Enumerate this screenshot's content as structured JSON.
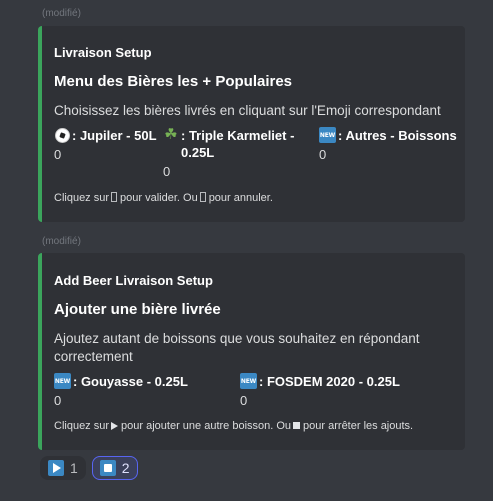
{
  "messages": [
    {
      "edited": "(modifié)",
      "author": "Livraison Setup",
      "title": "Menu des Bières les + Populaires",
      "description": "Choisissez les bières livrés en cliquant sur l'Emoji correspondant",
      "fields": [
        {
          "emoji": "soccer-ball",
          "name": ": Jupiler - 50L",
          "value": "0"
        },
        {
          "emoji": "four-leaf-clover",
          "name": ": Triple Karmeliet - 0.25L",
          "value": "0"
        },
        {
          "emoji": "new-button",
          "name": ": Autres - Boissons",
          "value": "0"
        }
      ],
      "footer": {
        "before": "Cliquez sur",
        "middle": "pour valider. Ou",
        "after": "pour annuler."
      }
    },
    {
      "edited": "(modifié)",
      "author": "Add Beer Livraison Setup",
      "title": "Ajouter une bière livrée",
      "description": "Ajoutez autant de boissons que vous souhaitez en répondant correctement",
      "fields": [
        {
          "emoji": "new-button",
          "name": ": Gouyasse - 0.25L",
          "value": "0"
        },
        {
          "emoji": "new-button",
          "name": ": FOSDEM 2020 - 0.25L",
          "value": "0"
        }
      ],
      "footer": {
        "before": "Cliquez sur",
        "middle": "pour ajouter une autre boisson. Ou",
        "after": "pour arrêter les ajouts."
      }
    }
  ],
  "new_badge_text": "NEW",
  "clover_glyph": "☘",
  "reactions": [
    {
      "emoji": "play-button",
      "count": "1",
      "me": false
    },
    {
      "emoji": "stop-button",
      "count": "2",
      "me": true
    }
  ],
  "colors": {
    "background": "#36393f",
    "embed_background": "#2f3136",
    "embed_accent": "#3ba55c",
    "reaction_me_border": "#5865f2",
    "new_badge": "#3b88c3"
  }
}
